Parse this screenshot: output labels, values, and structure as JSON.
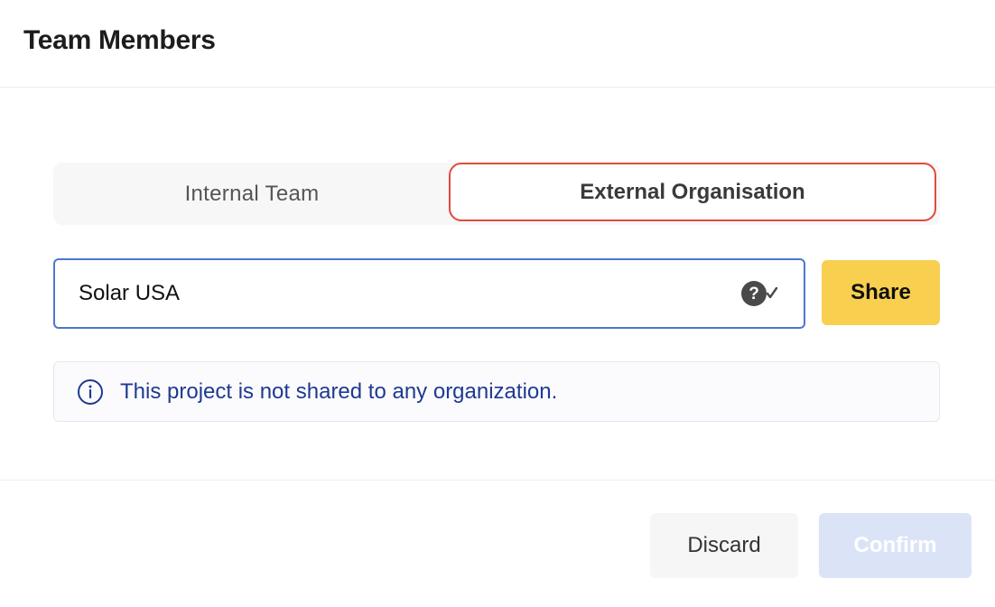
{
  "dialog": {
    "title": "Team Members"
  },
  "tabs": [
    {
      "label": "Internal Team",
      "active": false
    },
    {
      "label": "External Organisation",
      "active": true
    }
  ],
  "search": {
    "value": "Solar USA",
    "help_icon": "help-check-icon"
  },
  "share": {
    "label": "Share"
  },
  "info": {
    "icon": "info-icon",
    "text": "This project is not shared to any organization."
  },
  "footer": {
    "discard_label": "Discard",
    "confirm_label": "Confirm"
  },
  "colors": {
    "active_tab_border": "#e04a3f",
    "input_border": "#4d76d0",
    "share_button": "#f8cf4f",
    "info_text": "#1f3a8f",
    "confirm_disabled": "#dbe4f7"
  }
}
